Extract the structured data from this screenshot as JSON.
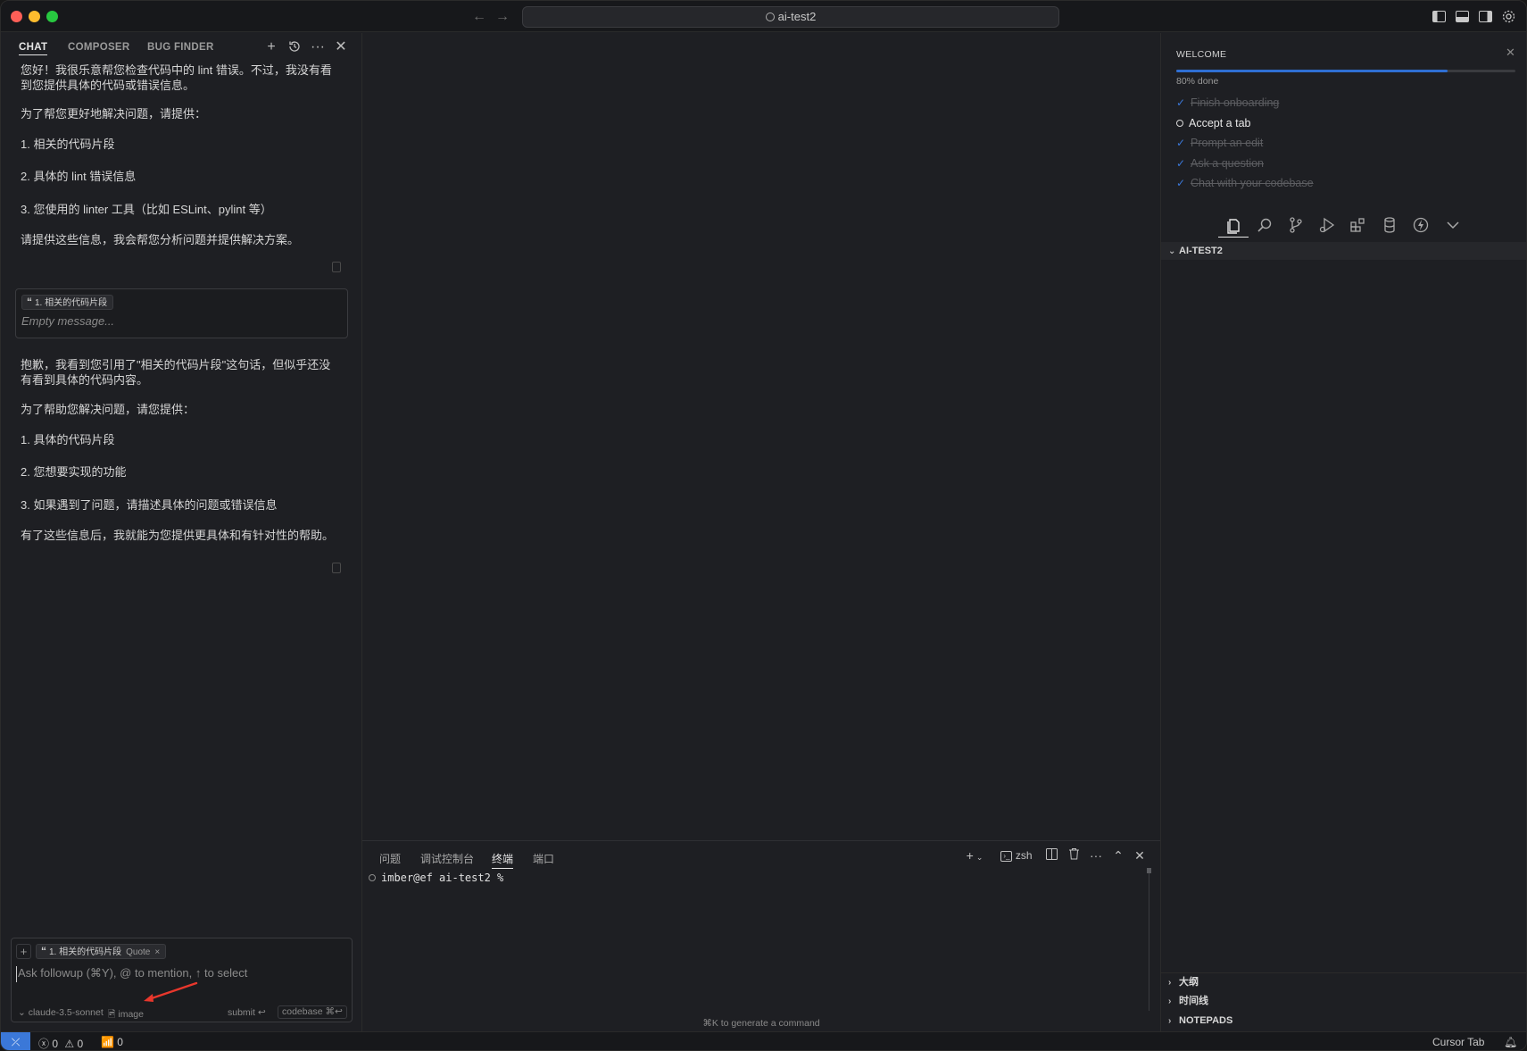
{
  "titlebar": {
    "search_text": "ai-test2",
    "back_icon": "arrow-left-icon",
    "forward_icon": "arrow-right-icon"
  },
  "chat": {
    "tabs": [
      "CHAT",
      "COMPOSER",
      "BUG FINDER"
    ],
    "active_tab": "CHAT",
    "reply1": {
      "intro": "您好！我很乐意帮您检查代码中的 lint 错误。不过，我没有看到您提供具体的代码或错误信息。",
      "ask": "为了帮您更好地解决问题，请提供：",
      "items": [
        "1. 相关的代码片段",
        "2. 具体的 lint 错误信息",
        "3. 您使用的 linter 工具（比如 ESLint、pylint 等）"
      ],
      "closing": "请提供这些信息，我会帮您分析问题并提供解决方案。"
    },
    "user_message": {
      "quote_chip": "1. 相关的代码片段",
      "text": "Empty message..."
    },
    "reply2": {
      "intro": "抱歉，我看到您引用了\"相关的代码片段\"这句话，但似乎还没有看到具体的代码内容。",
      "ask": "为了帮助您解决问题，请您提供：",
      "items": [
        "1. 具体的代码片段",
        "2. 您想要实现的功能",
        "3. 如果遇到了问题，请描述具体的问题或错误信息"
      ],
      "closing": "有了这些信息后，我就能为您提供更具体和有针对性的帮助。"
    },
    "composer": {
      "chip_text": "1. 相关的代码片段",
      "chip_suffix": "Quote",
      "placeholder": "Ask followup (⌘Y), @ to mention, ↑ to select",
      "model": "claude-3.5-sonnet",
      "image_label": "image",
      "submit_label": "submit ↩",
      "codebase_label": "codebase ⌘↩"
    }
  },
  "panel": {
    "tabs": [
      "问题",
      "调试控制台",
      "终端",
      "端口"
    ],
    "active_tab": "终端",
    "shell": "zsh",
    "prompt": "imber@ef ai-test2 %",
    "hint": "⌘K to generate a command"
  },
  "welcome": {
    "title": "WELCOME",
    "progress_percent": 80,
    "progress_label": "80% done",
    "tasks": [
      {
        "label": "Finish onboarding",
        "done": true
      },
      {
        "label": "Accept a tab",
        "done": false
      },
      {
        "label": "Prompt an edit",
        "done": true
      },
      {
        "label": "Ask a question",
        "done": true
      },
      {
        "label": "Chat with your codebase",
        "done": true
      }
    ]
  },
  "explorer": {
    "project": "AI-TEST2",
    "sections": [
      "大纲",
      "时间线",
      "NOTEPADS"
    ]
  },
  "statusbar": {
    "errors": "0",
    "warnings": "0",
    "ports": "0",
    "right_label": "Cursor Tab"
  },
  "colors": {
    "accent": "#3b78d8",
    "background": "#1e1f23",
    "annotation_arrow": "#e8372c"
  }
}
